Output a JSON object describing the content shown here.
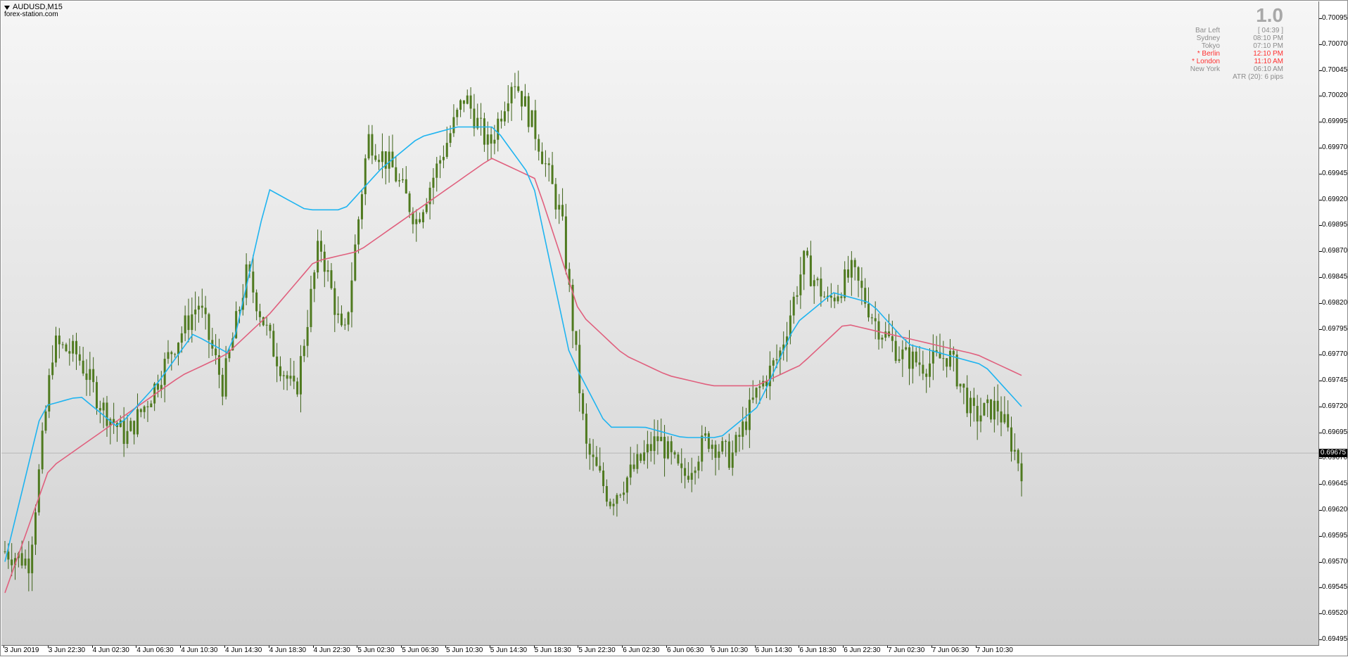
{
  "chart": {
    "symbol_label": "AUDUSD,M15",
    "watermark": "forex-station.com",
    "current_price": "0.69675"
  },
  "info_panel": {
    "big_value": "1.0",
    "rows": [
      {
        "label": "Bar Left",
        "value": "[ 04:39 ]",
        "highlight": false
      },
      {
        "label": "Sydney",
        "value": "08:10 PM",
        "highlight": false
      },
      {
        "label": "Tokyo",
        "value": "07:10 PM",
        "highlight": false
      },
      {
        "label": "* Berlin",
        "value": "12:10 PM",
        "highlight": true
      },
      {
        "label": "* London",
        "value": "11:10 AM",
        "highlight": true
      },
      {
        "label": "New York",
        "value": "06:10 AM",
        "highlight": false
      }
    ],
    "atr": "ATR (20): 6 pips"
  },
  "colors": {
    "candle_body": "#4f7a1f",
    "candle_wick": "#3d6218",
    "fast_ma": "#1fb4f0",
    "slow_ma": "#e0607e",
    "current_price_line": "#b8b8b8"
  },
  "chart_data": {
    "type": "candlestick",
    "ylim": [
      0.69495,
      0.70105
    ],
    "y_ticks": [
      "0.70095",
      "0.70070",
      "0.70045",
      "0.70020",
      "0.69995",
      "0.69970",
      "0.69945",
      "0.69920",
      "0.69895",
      "0.69870",
      "0.69845",
      "0.69820",
      "0.69795",
      "0.69770",
      "0.69745",
      "0.69720",
      "0.69695",
      "0.69670",
      "0.69645",
      "0.69620",
      "0.69595",
      "0.69570",
      "0.69545",
      "0.69520",
      "0.69495"
    ],
    "x_ticks": [
      "3 Jun 2019",
      "3 Jun 22:30",
      "4 Jun 02:30",
      "4 Jun 06:30",
      "4 Jun 10:30",
      "4 Jun 14:30",
      "4 Jun 18:30",
      "4 Jun 22:30",
      "5 Jun 02:30",
      "5 Jun 06:30",
      "5 Jun 10:30",
      "5 Jun 14:30",
      "5 Jun 18:30",
      "5 Jun 22:30",
      "6 Jun 02:30",
      "6 Jun 06:30",
      "6 Jun 10:30",
      "6 Jun 14:30",
      "6 Jun 18:30",
      "6 Jun 22:30",
      "7 Jun 02:30",
      "7 Jun 06:30",
      "7 Jun 10:30"
    ],
    "close_anchors": [
      0.6958,
      0.6957,
      0.6978,
      0.6977,
      0.6972,
      0.6969,
      0.6973,
      0.6978,
      0.6982,
      0.6974,
      0.6985,
      0.6978,
      0.6973,
      0.6988,
      0.6978,
      0.6998,
      0.6995,
      0.699,
      0.6996,
      0.7002,
      0.6997,
      0.7004,
      0.6998,
      0.699,
      0.6968,
      0.6963,
      0.6966,
      0.6969,
      0.6965,
      0.6969,
      0.6967,
      0.6973,
      0.6977,
      0.6986,
      0.6982,
      0.6985,
      0.698,
      0.6977,
      0.6976,
      0.6977,
      0.6971,
      0.6972,
      0.6966
    ],
    "fast_ma_anchors": [
      0.6957,
      0.6972,
      0.6973,
      0.697,
      0.6974,
      0.6979,
      0.6977,
      0.6993,
      0.6991,
      0.6991,
      0.6995,
      0.6998,
      0.6999,
      0.6999,
      0.6994,
      0.6977,
      0.697,
      0.697,
      0.6969,
      0.6969,
      0.6972,
      0.698,
      0.6983,
      0.6982,
      0.6978,
      0.6977,
      0.6976,
      0.6972
    ],
    "slow_ma_anchors": [
      0.6954,
      0.6966,
      0.6969,
      0.6972,
      0.6975,
      0.6977,
      0.6981,
      0.6986,
      0.6987,
      0.699,
      0.6993,
      0.6996,
      0.6994,
      0.6981,
      0.6977,
      0.6975,
      0.6974,
      0.6974,
      0.6976,
      0.698,
      0.6979,
      0.6978,
      0.6977,
      0.6975
    ]
  }
}
